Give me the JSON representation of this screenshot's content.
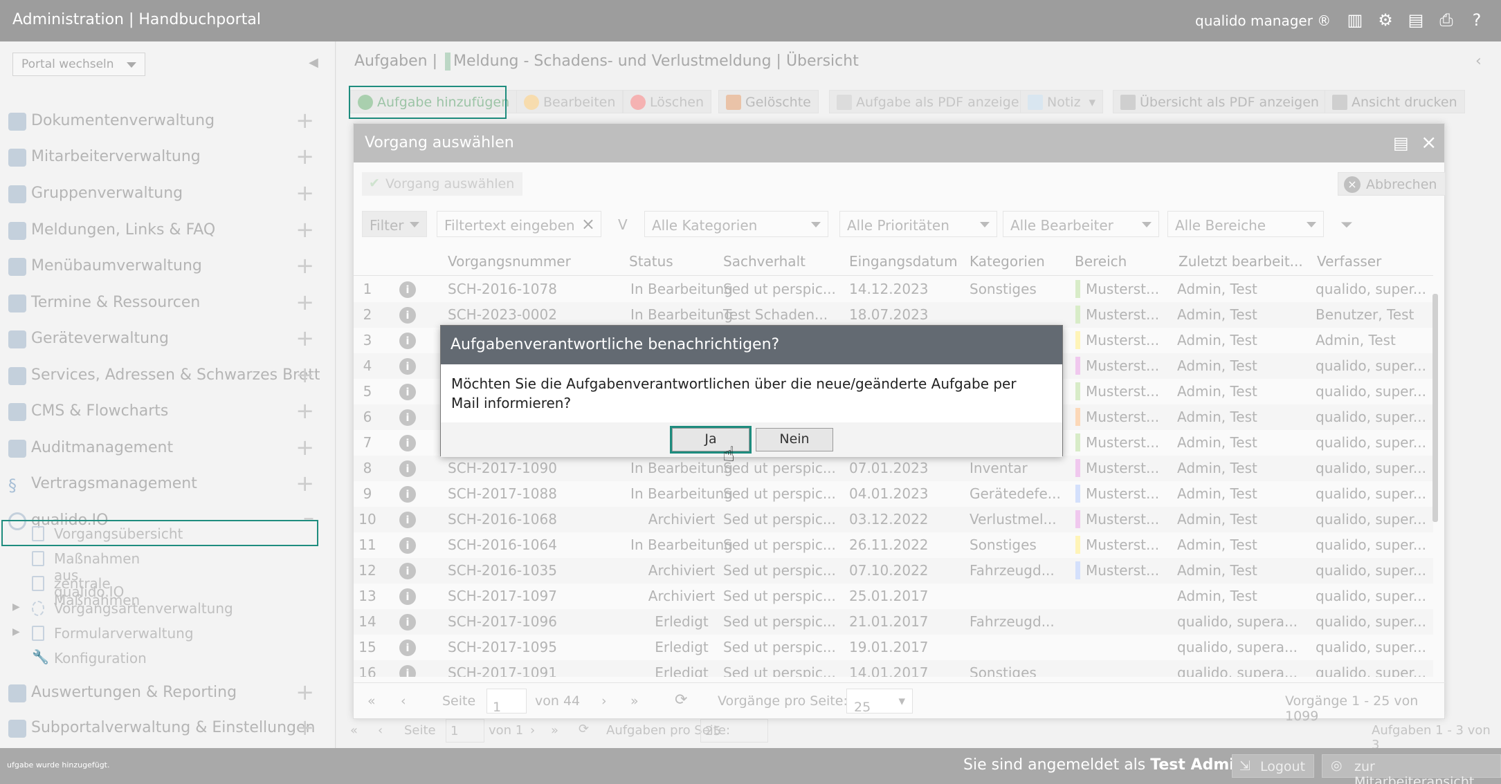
{
  "header": {
    "title": "Administration | Handbuchportal",
    "brand": "qualido manager ®",
    "icons": [
      "barcode-icon",
      "gears-icon",
      "pdf-icon",
      "print-icon",
      "help-icon"
    ]
  },
  "sidebar": {
    "portal_select": "Portal wechseln",
    "items": [
      {
        "label": "Dokumentenverwaltung",
        "icon": "document-icon"
      },
      {
        "label": "Mitarbeiterverwaltung",
        "icon": "users-icon"
      },
      {
        "label": "Gruppenverwaltung",
        "icon": "group-icon"
      },
      {
        "label": "Meldungen, Links & FAQ",
        "icon": "chat-icon"
      },
      {
        "label": "Menübaumverwaltung",
        "icon": "list-icon"
      },
      {
        "label": "Termine & Ressourcen",
        "icon": "calendar-icon"
      },
      {
        "label": "Geräteverwaltung",
        "icon": "device-icon"
      },
      {
        "label": "Services, Adressen & Schwarzes Brett",
        "icon": "address-book-icon"
      },
      {
        "label": "CMS & Flowcharts",
        "icon": "cms-icon"
      },
      {
        "label": "Auditmanagement",
        "icon": "audit-icon"
      },
      {
        "label": "Vertragsmanagement",
        "icon": "paragraph-icon"
      },
      {
        "label": "qualido.IO",
        "icon": "qualido-io-icon"
      }
    ],
    "subitems": [
      {
        "label": "Vorgangsübersicht"
      },
      {
        "label": "Maßnahmen aus qualido.IO"
      },
      {
        "label": "zentrale Maßnahmen"
      },
      {
        "label": "Vorgangsartenverwaltung"
      },
      {
        "label": "Formularverwaltung"
      },
      {
        "label": "Konfiguration"
      }
    ],
    "bottom_items": [
      {
        "label": "Auswertungen & Reporting",
        "icon": "chart-icon"
      },
      {
        "label": "Subportalverwaltung & Einstellungen",
        "icon": "home-icon"
      }
    ]
  },
  "main": {
    "breadcrumb_a": "Aufgaben |",
    "breadcrumb_b": "Meldung - Schadens- und Verlustmeldung | Übersicht",
    "toolbar": [
      "Aufgabe hinzufügen",
      "Bearbeiten",
      "Löschen",
      "Gelöschte",
      "Aufgabe als PDF anzeigen",
      "Notiz",
      "Übersicht als PDF anzeigen",
      "Ansicht drucken"
    ],
    "pager": {
      "seite": "Seite",
      "page": "1",
      "von": "von 1",
      "per_page_label": "Aufgaben pro Seite:",
      "per_page": "25",
      "summary": "Aufgaben 1 - 3 von 3"
    }
  },
  "dialog": {
    "title": "Vorgang auswählen",
    "select_btn": "Vorgang auswählen",
    "cancel_btn": "Abbrechen",
    "filter": {
      "filter_btn": "Filter",
      "placeholder": "Filtertext eingeben",
      "v": "V",
      "kategorien": "Alle Kategorien",
      "prioritaeten": "Alle Prioritäten",
      "bearbeiter": "Alle Bearbeiter",
      "bereiche": "Alle Bereiche"
    },
    "columns": [
      "Vorgangsnummer",
      "Status",
      "Sachverhalt",
      "Eingangsdatum",
      "Kategorien",
      "Bereich",
      "Zuletzt bearbeit...",
      "Verfasser"
    ],
    "rows": [
      {
        "n": "1",
        "nr": "SCH-2016-1078",
        "status": "In Bearbeitung",
        "sach": "Sed ut perspic...",
        "datum": "14.12.2023",
        "kat": "Sonstiges",
        "bereich": "Musterst...",
        "bcolor": "#d8ecc8",
        "zul": "Admin, Test",
        "verf": "qualido, super..."
      },
      {
        "n": "2",
        "nr": "SCH-2023-0002",
        "status": "In Bearbeitung",
        "sach": "Test Schaden...",
        "datum": "18.07.2023",
        "kat": "",
        "bereich": "Musterst...",
        "bcolor": "#d8ecc8",
        "zul": "Admin, Test",
        "verf": "Benutzer, Test"
      },
      {
        "n": "3",
        "nr": "",
        "status": "",
        "sach": "",
        "datum": "",
        "kat": "",
        "bereich": "Musterst...",
        "bcolor": "#fff4b8",
        "zul": "Admin, Test",
        "verf": "Admin, Test"
      },
      {
        "n": "4",
        "nr": "",
        "status": "",
        "sach": "",
        "datum": "",
        "kat": "",
        "bereich": "Musterst...",
        "bcolor": "#f0c8ee",
        "zul": "Admin, Test",
        "verf": "qualido, super..."
      },
      {
        "n": "5",
        "nr": "",
        "status": "",
        "sach": "",
        "datum": "",
        "kat": "",
        "bereich": "Musterst...",
        "bcolor": "#d8ecc8",
        "zul": "Admin, Test",
        "verf": "qualido, super..."
      },
      {
        "n": "6",
        "nr": "",
        "status": "",
        "sach": "",
        "datum": "",
        "kat": "",
        "bereich": "Musterst...",
        "bcolor": "#fcd8b8",
        "zul": "Admin, Test",
        "verf": "qualido, super..."
      },
      {
        "n": "7",
        "nr": "",
        "status": "",
        "sach": "",
        "datum": "",
        "kat": "",
        "bereich": "Musterst...",
        "bcolor": "#d8ecc8",
        "zul": "Admin, Test",
        "verf": "qualido, super..."
      },
      {
        "n": "8",
        "nr": "SCH-2017-1090",
        "status": "In Bearbeitung",
        "sach": "Sed ut perspic...",
        "datum": "07.01.2023",
        "kat": "Inventar",
        "bereich": "Musterst...",
        "bcolor": "#f0c8ee",
        "zul": "Admin, Test",
        "verf": "qualido, super..."
      },
      {
        "n": "9",
        "nr": "SCH-2017-1088",
        "status": "In Bearbeitung",
        "sach": "Sed ut perspic...",
        "datum": "04.01.2023",
        "kat": "Gerätedefe...",
        "bereich": "Musterst...",
        "bcolor": "#d4e0fc",
        "zul": "Admin, Test",
        "verf": "qualido, super..."
      },
      {
        "n": "10",
        "nr": "SCH-2016-1068",
        "status": "Archiviert",
        "sach": "Sed ut perspic...",
        "datum": "03.12.2022",
        "kat": "Verlustmel...",
        "bereich": "Musterst...",
        "bcolor": "#f0c8ee",
        "zul": "Admin, Test",
        "verf": "qualido, super..."
      },
      {
        "n": "11",
        "nr": "SCH-2016-1064",
        "status": "In Bearbeitung",
        "sach": "Sed ut perspic...",
        "datum": "26.11.2022",
        "kat": "Sonstiges",
        "bereich": "Musterst...",
        "bcolor": "#fff4b8",
        "zul": "Admin, Test",
        "verf": "qualido, super..."
      },
      {
        "n": "12",
        "nr": "SCH-2016-1035",
        "status": "Archiviert",
        "sach": "Sed ut perspic...",
        "datum": "07.10.2022",
        "kat": "Fahrzeugd...",
        "bereich": "Musterst...",
        "bcolor": "#d4e0fc",
        "zul": "Admin, Test",
        "verf": "qualido, super..."
      },
      {
        "n": "13",
        "nr": "SCH-2017-1097",
        "status": "Archiviert",
        "sach": "Sed ut perspic...",
        "datum": "25.01.2017",
        "kat": "",
        "bereich": "",
        "bcolor": "",
        "zul": "Admin, Test",
        "verf": "qualido, super..."
      },
      {
        "n": "14",
        "nr": "SCH-2017-1096",
        "status": "Erledigt",
        "sach": "Sed ut perspic...",
        "datum": "21.01.2017",
        "kat": "Fahrzeugd...",
        "bereich": "",
        "bcolor": "",
        "zul": "qualido, supera...",
        "verf": "qualido, super..."
      },
      {
        "n": "15",
        "nr": "SCH-2017-1095",
        "status": "Erledigt",
        "sach": "Sed ut perspic...",
        "datum": "19.01.2017",
        "kat": "",
        "bereich": "",
        "bcolor": "",
        "zul": "qualido, supera...",
        "verf": "qualido, super..."
      },
      {
        "n": "16",
        "nr": "SCH-2017-1091",
        "status": "Erledigt",
        "sach": "Sed ut perspic...",
        "datum": "14.01.2017",
        "kat": "Sonstiges",
        "bereich": "",
        "bcolor": "",
        "zul": "qualido, supera...",
        "verf": "qualido, super..."
      }
    ],
    "pager": {
      "seite": "Seite",
      "page": "1",
      "von": "von 44",
      "per_page_label": "Vorgänge pro Seite:",
      "per_page": "25",
      "summary": "Vorgänge 1 - 25 von 1099"
    }
  },
  "confirm": {
    "title": "Aufgabenverantwortliche benachrichtigen?",
    "body": "Möchten Sie die Aufgabenverantwortlichen über die neue/geänderte Aufgabe per Mail informieren?",
    "yes": "Ja",
    "no": "Nein"
  },
  "status": {
    "message": "ufgabe wurde hinzugefügt.",
    "logged_in_prefix": "Sie sind angemeldet als",
    "user": "Test Admin",
    "logout": "Logout",
    "employee_view": "zur Mitarbeiteransicht"
  },
  "colors": {
    "accent": "#1e8c7e",
    "header": "#9d9d9d",
    "confirm_header": "#636a72"
  }
}
